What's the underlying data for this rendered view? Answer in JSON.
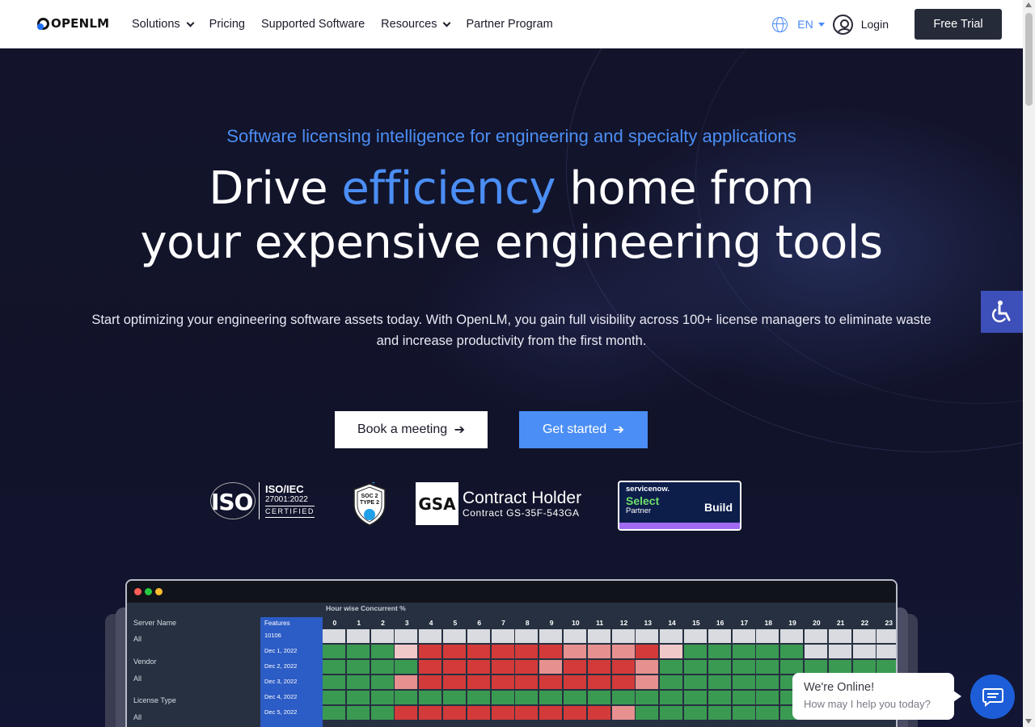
{
  "nav": {
    "logo": "OPENLM",
    "links": [
      {
        "label": "Solutions",
        "dropdown": true
      },
      {
        "label": "Pricing",
        "dropdown": false
      },
      {
        "label": "Supported Software",
        "dropdown": false
      },
      {
        "label": "Resources",
        "dropdown": true
      },
      {
        "label": "Partner Program",
        "dropdown": false
      }
    ],
    "language": "EN",
    "login": "Login",
    "cta": "Free Trial"
  },
  "hero": {
    "subtitle": "Software licensing intelligence for engineering and specialty applications",
    "headline_pre": "Drive ",
    "headline_accent": "efficiency",
    "headline_post": " home from",
    "headline_line2": "your expensive engineering tools",
    "description": "Start optimizing your engineering software assets today. With OpenLM, you gain full visibility across 100+ license managers to eliminate waste and increase productivity from the first month.",
    "btn_meeting": "Book a meeting",
    "btn_start": "Get started",
    "arrow": "➔"
  },
  "certs": {
    "iso": {
      "logo": "ISO",
      "title": "ISO/IEC",
      "std": "27001:2022",
      "status": "CERTIFIED"
    },
    "soc": {
      "line1": "SOC 2",
      "line2": "TYPE 2"
    },
    "gsa": {
      "logo": "GSA",
      "title": "Contract Holder",
      "contract": "Contract GS-35F-543GA"
    },
    "servicenow": {
      "brand": "servicenow.",
      "tier": "Select",
      "role": "Partner",
      "track": "Build"
    }
  },
  "dashboard": {
    "chart_title": "Hour wise Concurrent %",
    "filters": [
      {
        "label": "Server Name",
        "value": "All"
      },
      {
        "label": "Vendor",
        "value": "All"
      },
      {
        "label": "License Type",
        "value": "All"
      }
    ],
    "feature_header": "Features",
    "feature_id": "10106",
    "hours": [
      "0",
      "1",
      "2",
      "3",
      "4",
      "5",
      "6",
      "7",
      "8",
      "9",
      "10",
      "11",
      "12",
      "13",
      "14",
      "15",
      "16",
      "17",
      "18",
      "19",
      "20",
      "21",
      "22",
      "23"
    ],
    "dates": [
      "Dec 1, 2022",
      "Dec 2, 2022",
      "Dec 3, 2022",
      "Dec 4, 2022",
      "Dec 5, 2022"
    ]
  },
  "chat": {
    "title": "We're Online!",
    "subtitle": "How may I help you today?"
  }
}
